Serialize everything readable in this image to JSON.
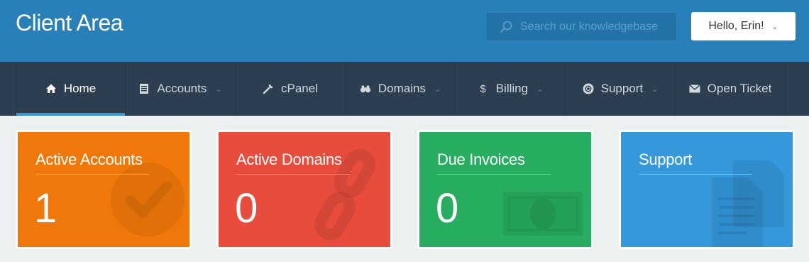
{
  "header": {
    "title": "Client Area",
    "search_placeholder": "Search our knowledgebase",
    "user_greeting": "Hello, Erin!"
  },
  "nav": {
    "items": [
      {
        "label": "Home",
        "icon": "home-icon",
        "active": true,
        "dropdown": false
      },
      {
        "label": "Accounts",
        "icon": "document-icon",
        "dropdown": true
      },
      {
        "label": "cPanel",
        "icon": "wrench-icon",
        "dropdown": false
      },
      {
        "label": "Domains",
        "icon": "binoculars-icon",
        "dropdown": true
      },
      {
        "label": "Billing",
        "icon": "dollar-icon",
        "dropdown": true
      },
      {
        "label": "Support",
        "icon": "lifebuoy-icon",
        "dropdown": true
      },
      {
        "label": "Open Ticket",
        "icon": "envelope-icon",
        "dropdown": false
      }
    ]
  },
  "tiles": [
    {
      "title": "Active Accounts",
      "value": "1",
      "icon": "checkmark-icon",
      "color": "#f0780a"
    },
    {
      "title": "Active Domains",
      "value": "0",
      "icon": "chain-link-icon",
      "color": "#e74c3c"
    },
    {
      "title": "Due Invoices",
      "value": "0",
      "icon": "banknote-icon",
      "color": "#27ae60"
    },
    {
      "title": "Support",
      "icon": "documents-icon",
      "color": "#3498db"
    }
  ],
  "colors": {
    "header_bg": "#2980b9",
    "nav_bg": "#2c3e50",
    "active_underline": "#3498db",
    "page_bg": "#ecf0f1"
  }
}
